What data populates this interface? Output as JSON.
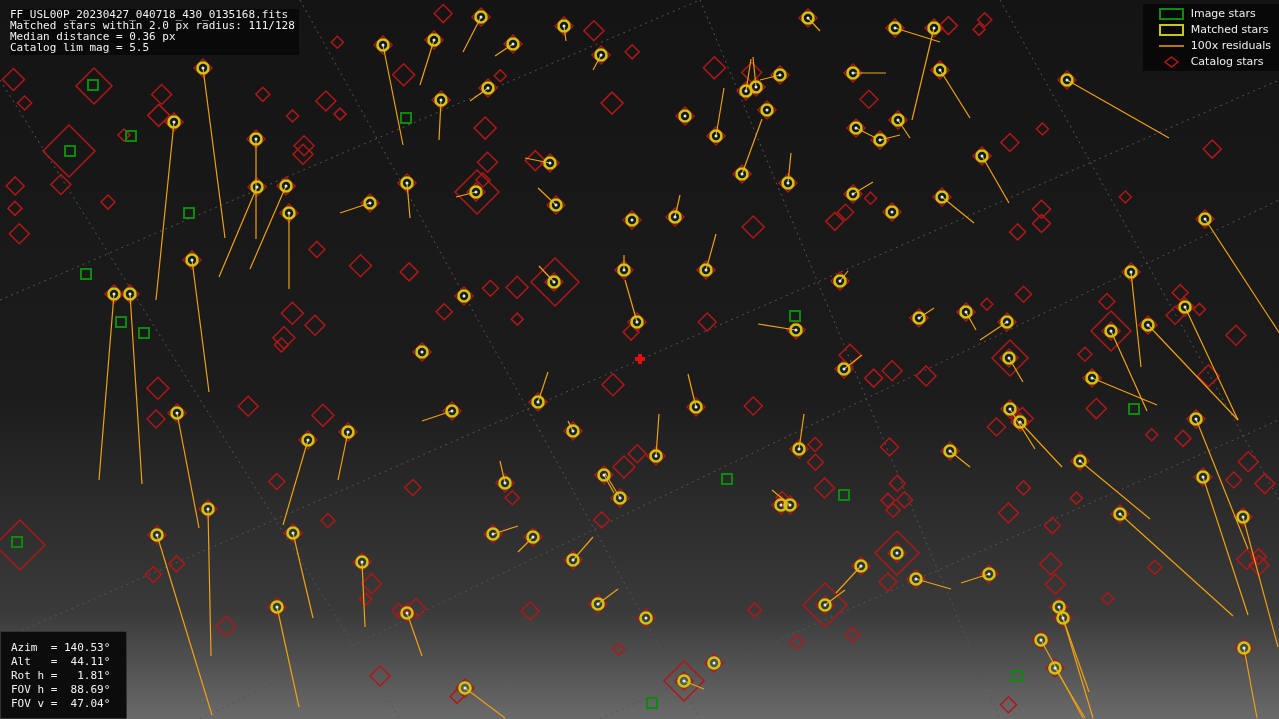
{
  "file_info": {
    "lines": [
      "FF_USL00P_20230427_040718_430_0135168.fits",
      "Matched stars within 2.0 px radius: 111/128",
      "Median distance = 0.36 px",
      "Catalog lim mag = 5.5"
    ]
  },
  "legend": {
    "items": [
      {
        "kind": "image",
        "label": "Image stars"
      },
      {
        "kind": "matched",
        "label": "Matched stars"
      },
      {
        "kind": "residual",
        "label": "100x residuals"
      },
      {
        "kind": "catalog",
        "label": "Catalog stars"
      }
    ]
  },
  "pointing": {
    "lines": [
      "Azim  = 140.53°",
      "Alt   =  44.11°",
      "Rot h =   1.81°",
      "FOV h =  88.69°",
      "FOV v =  47.04°"
    ]
  }
}
